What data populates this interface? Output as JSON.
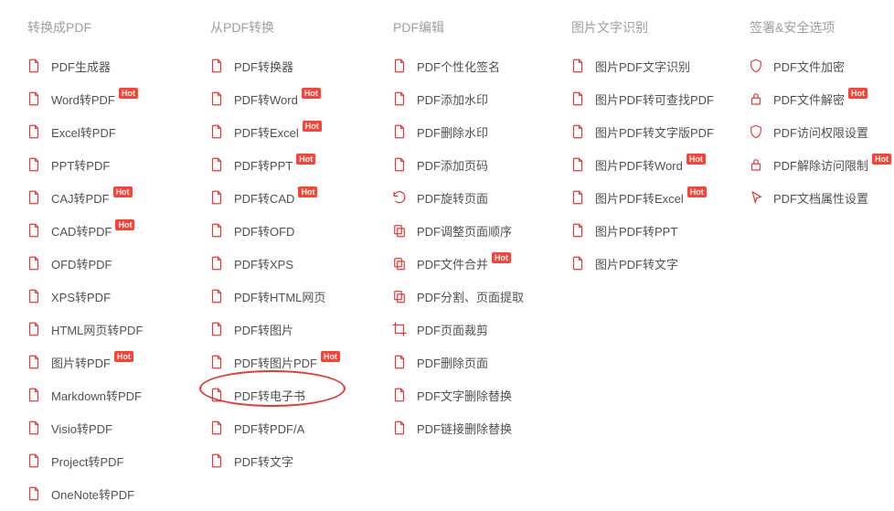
{
  "badge_hot": "Hot",
  "columns": [
    {
      "header": "转换成PDF",
      "items": [
        {
          "label": "PDF生成器",
          "hot": false
        },
        {
          "label": "Word转PDF",
          "hot": true
        },
        {
          "label": "Excel转PDF",
          "hot": false
        },
        {
          "label": "PPT转PDF",
          "hot": false
        },
        {
          "label": "CAJ转PDF",
          "hot": true
        },
        {
          "label": "CAD转PDF",
          "hot": true
        },
        {
          "label": "OFD转PDF",
          "hot": false
        },
        {
          "label": "XPS转PDF",
          "hot": false
        },
        {
          "label": "HTML网页转PDF",
          "hot": false
        },
        {
          "label": "图片转PDF",
          "hot": true
        },
        {
          "label": "Markdown转PDF",
          "hot": false
        },
        {
          "label": "Visio转PDF",
          "hot": false
        },
        {
          "label": "Project转PDF",
          "hot": false
        },
        {
          "label": "OneNote转PDF",
          "hot": false
        }
      ]
    },
    {
      "header": "从PDF转换",
      "items": [
        {
          "label": "PDF转换器",
          "hot": false
        },
        {
          "label": "PDF转Word",
          "hot": true
        },
        {
          "label": "PDF转Excel",
          "hot": true
        },
        {
          "label": "PDF转PPT",
          "hot": true
        },
        {
          "label": "PDF转CAD",
          "hot": true
        },
        {
          "label": "PDF转OFD",
          "hot": false
        },
        {
          "label": "PDF转XPS",
          "hot": false
        },
        {
          "label": "PDF转HTML网页",
          "hot": false
        },
        {
          "label": "PDF转图片",
          "hot": false
        },
        {
          "label": "PDF转图片PDF",
          "hot": true
        },
        {
          "label": "PDF转电子书",
          "hot": false,
          "highlighted": true
        },
        {
          "label": "PDF转PDF/A",
          "hot": false
        },
        {
          "label": "PDF转文字",
          "hot": false
        }
      ]
    },
    {
      "header": "PDF编辑",
      "items": [
        {
          "label": "PDF个性化签名",
          "hot": false
        },
        {
          "label": "PDF添加水印",
          "hot": false
        },
        {
          "label": "PDF删除水印",
          "hot": false
        },
        {
          "label": "PDF添加页码",
          "hot": false
        },
        {
          "label": "PDF旋转页面",
          "hot": false
        },
        {
          "label": "PDF调整页面顺序",
          "hot": false
        },
        {
          "label": "PDF文件合并",
          "hot": true
        },
        {
          "label": "PDF分割、页面提取",
          "hot": false
        },
        {
          "label": "PDF页面裁剪",
          "hot": false
        },
        {
          "label": "PDF删除页面",
          "hot": false
        },
        {
          "label": "PDF文字删除替换",
          "hot": false
        },
        {
          "label": "PDF链接删除替换",
          "hot": false
        }
      ]
    },
    {
      "header": "图片文字识别",
      "items": [
        {
          "label": "图片PDF文字识别",
          "hot": false
        },
        {
          "label": "图片PDF转可查找PDF",
          "hot": false
        },
        {
          "label": "图片PDF转文字版PDF",
          "hot": false
        },
        {
          "label": "图片PDF转Word",
          "hot": true
        },
        {
          "label": "图片PDF转Excel",
          "hot": true
        },
        {
          "label": "图片PDF转PPT",
          "hot": false
        },
        {
          "label": "图片PDF转文字",
          "hot": false
        }
      ]
    },
    {
      "header": "签署&安全选项",
      "items": [
        {
          "label": "PDF文件加密",
          "hot": false
        },
        {
          "label": "PDF文件解密",
          "hot": true
        },
        {
          "label": "PDF访问权限设置",
          "hot": false
        },
        {
          "label": "PDF解除访问限制",
          "hot": true
        },
        {
          "label": "PDF文档属性设置",
          "hot": false
        }
      ]
    }
  ],
  "colors": {
    "accent": "#e53935",
    "muted": "#9e9e9e",
    "text": "#515151"
  }
}
